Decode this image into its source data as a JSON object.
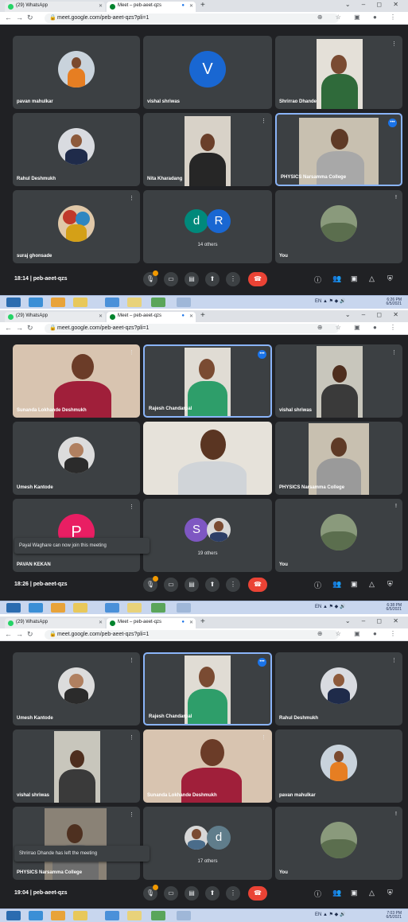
{
  "browser": {
    "tabs": [
      {
        "label": "(29) WhatsApp"
      },
      {
        "label": "Meet – peb-aeet-qzs"
      }
    ],
    "url": "meet.google.com/peb-aeet-qzs?pli=1"
  },
  "screens": [
    {
      "time": "18:14",
      "meeting_code": "peb-aeet-qzs",
      "tiles": [
        {
          "name": "pavan mahulkar"
        },
        {
          "name": "vishal shriwas",
          "avatar_letter": "V"
        },
        {
          "name": "Shrirrao Dhande"
        },
        {
          "name": "Rahul Deshmukh"
        },
        {
          "name": "Nita Kharadang"
        },
        {
          "name": "PHYSICS Narsamma College"
        },
        {
          "name": "suraj ghonsade"
        },
        {
          "name": "14 others",
          "letters": [
            "d",
            "R"
          ]
        },
        {
          "name": "You"
        }
      ]
    },
    {
      "time": "18:26",
      "meeting_code": "peb-aeet-qzs",
      "tiles": [
        {
          "name": "Sunanda Lokhande Deshmukh"
        },
        {
          "name": "Rajesh Chandarpal"
        },
        {
          "name": "vishal shriwas"
        },
        {
          "name": "Umesh Kantode"
        },
        {
          "name": ""
        },
        {
          "name": "PHYSICS Narsamma College"
        },
        {
          "name": "PAVAN KEKAN",
          "avatar_letter": "P"
        },
        {
          "name": "19 others",
          "letters": [
            "S"
          ]
        },
        {
          "name": "You"
        }
      ],
      "toast": "Payal Waghare can now join this meeting"
    },
    {
      "time": "19:04",
      "meeting_code": "peb-aeet-qzs",
      "tiles": [
        {
          "name": "Umesh Kantode"
        },
        {
          "name": "Rajesh Chandarpal"
        },
        {
          "name": "Rahul Deshmukh"
        },
        {
          "name": "vishal shriwas"
        },
        {
          "name": "Sunanda Lokhande Deshmukh"
        },
        {
          "name": "pavan mahulkar"
        },
        {
          "name": "PHYSICS Narsamma College"
        },
        {
          "name": "17 others",
          "letters": [
            "d"
          ]
        },
        {
          "name": "You"
        }
      ],
      "toast": "Shrirrao Dhande has left the meeting"
    }
  ],
  "taskbar": {
    "times": [
      "6:26 PM",
      "6:38 PM",
      "7:03 PM"
    ],
    "date": "6/5/2021",
    "lang": "EN"
  },
  "colors": {
    "meet_bg": "#202124",
    "tile_bg": "#3c4043",
    "active_border": "#8ab4f8",
    "end_call": "#ea4335",
    "avatar_blue": "#1967d2",
    "avatar_pink": "#e91e63",
    "avatar_purple": "#7e57c2",
    "avatar_teal": "#00897b"
  },
  "icons": [
    "back-icon",
    "forward-icon",
    "reload-icon",
    "lock-icon",
    "mic-icon",
    "camera-icon",
    "captions-icon",
    "present-icon",
    "more-icon",
    "end-call-icon",
    "info-icon",
    "people-icon",
    "chat-icon",
    "activities-icon",
    "host-controls-icon"
  ]
}
